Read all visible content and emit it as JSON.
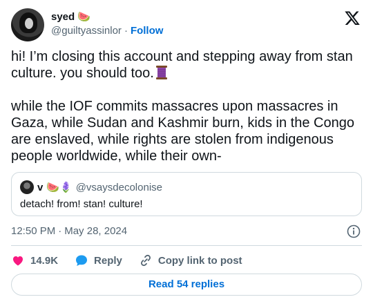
{
  "author": {
    "name": "syed",
    "name_emoji": "🍉",
    "handle": "@guiltyassinlor",
    "separator": "·",
    "follow_label": "Follow"
  },
  "tweet": {
    "text_p1": "hi! I’m closing this account and stepping away from stan culture. you should too.",
    "text_p2": "while the IOF commits massacres upon massacres in Gaza, while Sudan and Kashmir burn, kids in the Congo are enslaved, while rights are stolen from indigenous people worldwide, while their own-"
  },
  "quote": {
    "name": "v",
    "name_emojis": "🍉🪻",
    "handle": "@vsaysdecolonise",
    "text": "detach! from! stan! culture!"
  },
  "meta": {
    "time": "12:50 PM",
    "separator": "·",
    "date": "May 28, 2024"
  },
  "actions": {
    "likes": "14.9K",
    "reply": "Reply",
    "copy": "Copy link to post"
  },
  "read_replies": "Read 54 replies",
  "colors": {
    "like": "#f91880",
    "reply": "#1d9bf0",
    "link": "#006fd6",
    "muted": "#536471",
    "border": "#cfd9de"
  }
}
